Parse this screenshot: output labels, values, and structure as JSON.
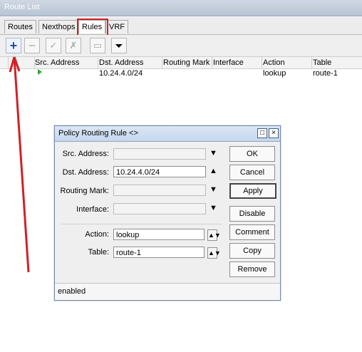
{
  "window": {
    "title": "Route List"
  },
  "tabs": [
    {
      "label": "Routes"
    },
    {
      "label": "Nexthops"
    },
    {
      "label": "Rules"
    },
    {
      "label": "VRF"
    }
  ],
  "icons": {
    "add": "+",
    "remove": "−",
    "enable": "✓",
    "disable": "✗",
    "comment": "▭",
    "filter": "⏷"
  },
  "table": {
    "headers": [
      "Src. Address",
      "Dst. Address",
      "Routing Mark",
      "Interface",
      "Action",
      "Table"
    ],
    "rows": [
      {
        "src": "",
        "dst": "10.24.4.0/24",
        "mark": "",
        "interface": "",
        "action": "lookup",
        "table": "route-1"
      }
    ]
  },
  "dialog": {
    "title": "Policy Routing Rule <>",
    "labels": {
      "src": "Src. Address:",
      "dst": "Dst. Address:",
      "mark": "Routing Mark:",
      "iface": "Interface:",
      "action": "Action:",
      "table": "Table:"
    },
    "values": {
      "src": "",
      "dst": "10.24.4.0/24",
      "mark": "",
      "iface": "",
      "action": "lookup",
      "table": "route-1"
    },
    "buttons": [
      "OK",
      "Cancel",
      "Apply",
      "Disable",
      "Comment",
      "Copy",
      "Remove"
    ],
    "status": "enabled"
  },
  "colors": {
    "highlight": "#d12027",
    "annotation_arrow": "#d12027"
  }
}
